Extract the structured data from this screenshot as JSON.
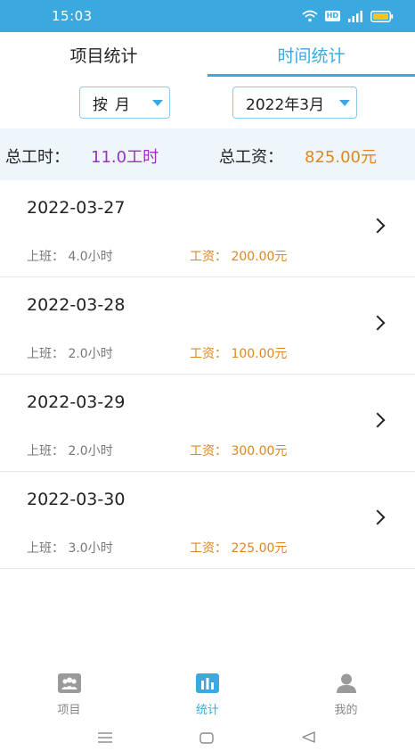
{
  "status_bar": {
    "time": "15:03",
    "hd_label": "HD",
    "icons": [
      "wifi-icon",
      "hd-icon",
      "signal-icon",
      "battery-icon"
    ]
  },
  "tabs": [
    {
      "label": "项目统计",
      "active": false
    },
    {
      "label": "时间统计",
      "active": true
    }
  ],
  "filters": {
    "unit_label": "按月",
    "month_label": "2022年3月"
  },
  "summary": {
    "hours_label": "总工时：",
    "hours_value": "11.0工时",
    "wage_label": "总工资：",
    "wage_value": "825.00元"
  },
  "records": [
    {
      "date": "2022-03-27",
      "work": "上班： 4.0小时",
      "wage": "工资： 200.00元"
    },
    {
      "date": "2022-03-28",
      "work": "上班： 2.0小时",
      "wage": "工资： 100.00元"
    },
    {
      "date": "2022-03-29",
      "work": "上班： 2.0小时",
      "wage": "工资： 300.00元"
    },
    {
      "date": "2022-03-30",
      "work": "上班： 3.0小时",
      "wage": "工资： 225.00元"
    }
  ],
  "bottom_nav": [
    {
      "label": "项目",
      "icon": "team-icon",
      "active": false
    },
    {
      "label": "统计",
      "icon": "bar-chart-icon",
      "active": true
    },
    {
      "label": "我的",
      "icon": "user-icon",
      "active": false
    }
  ],
  "colors": {
    "accent": "#3ba9e0",
    "hours": "#9b2fc9",
    "wage": "#e0861e",
    "summary_bg": "#eef6fb"
  }
}
